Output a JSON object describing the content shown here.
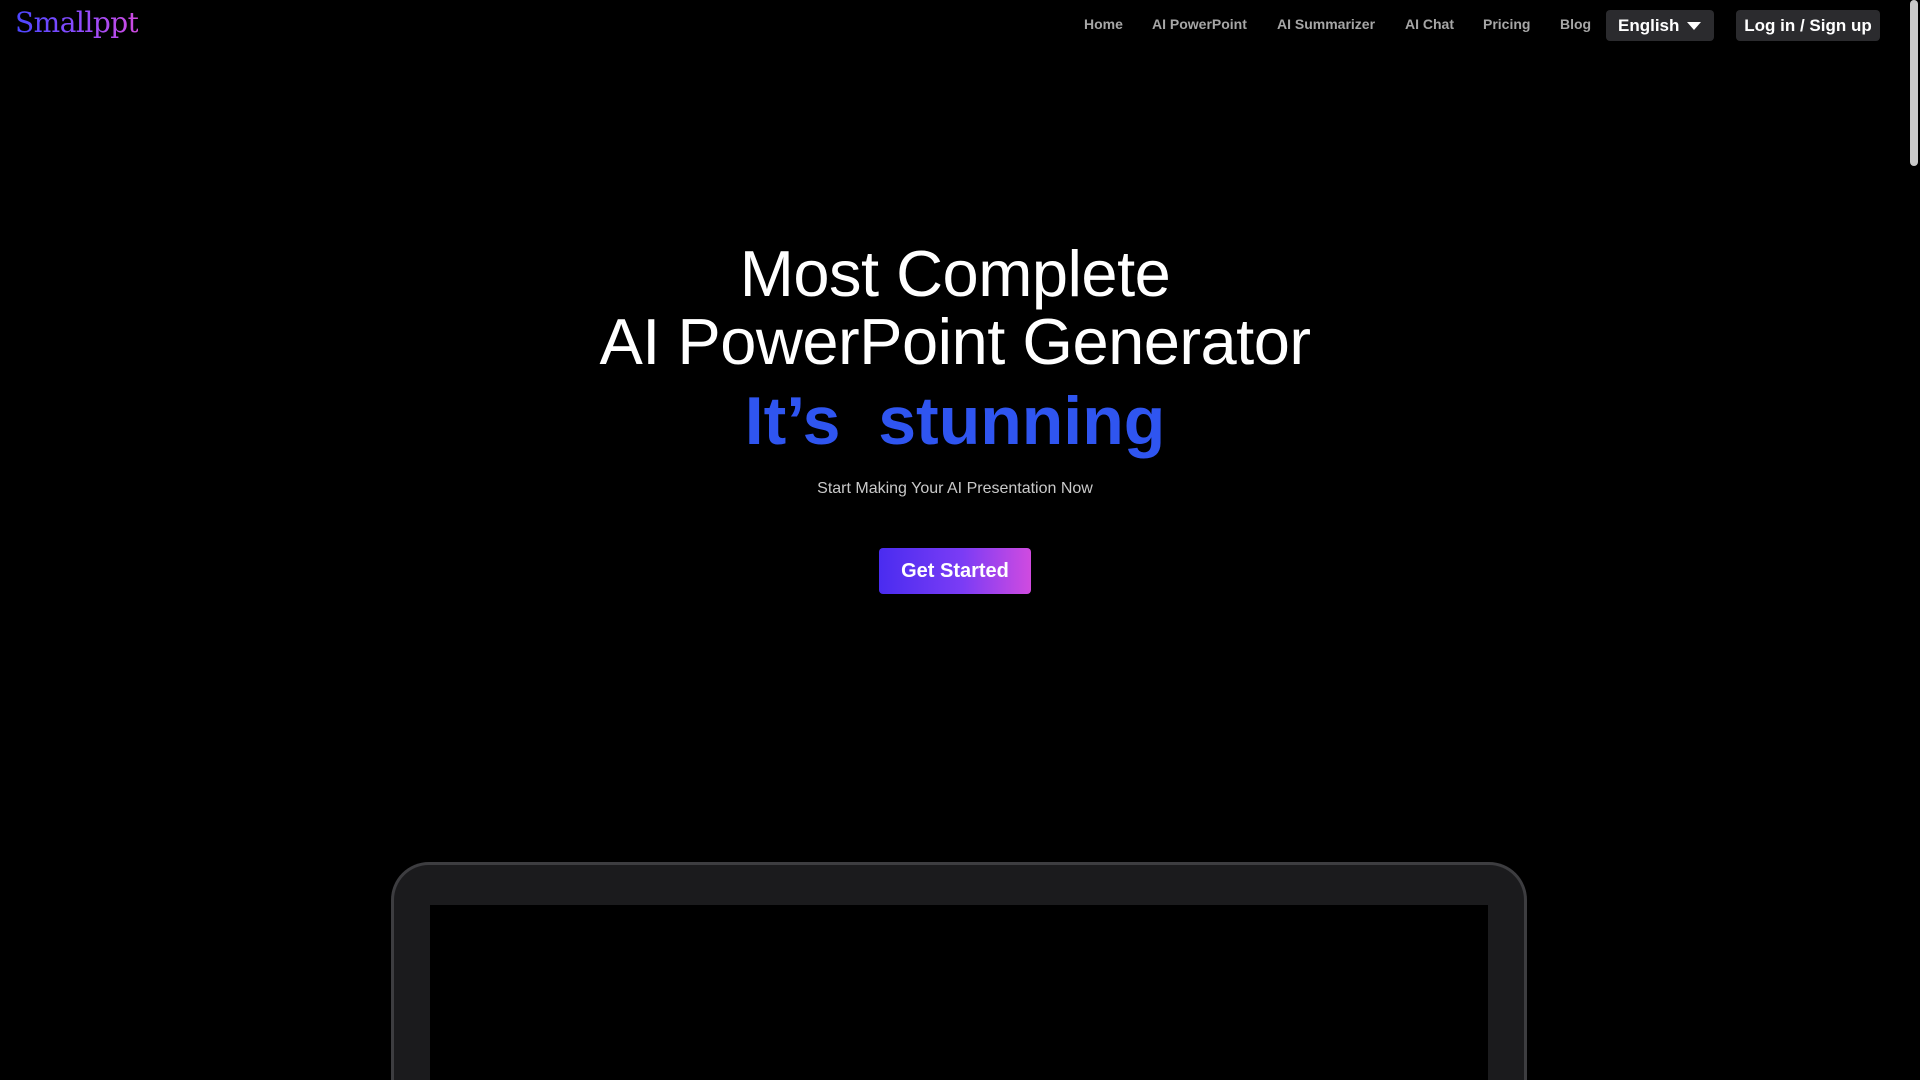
{
  "brand": {
    "logo_text": "Smallppt"
  },
  "nav": {
    "items": [
      "Home",
      "AI PowerPoint",
      "AI Summarizer",
      "AI Chat",
      "Pricing",
      "Blog"
    ],
    "language": "English",
    "login_label": "Log in / Sign up"
  },
  "hero": {
    "title_line1": "Most Complete",
    "title_line2": "AI PowerPoint Generator",
    "accent_text": "It’s  stunning",
    "subtitle": "Start Making Your AI Presentation Now",
    "cta_label": "Get Started"
  },
  "colors": {
    "accent_blue": "#2f55f0",
    "cta_gradient_start": "#4a2cf0",
    "cta_gradient_end": "#d04be0"
  },
  "icons": {
    "language_caret": "chevron-down-icon"
  }
}
